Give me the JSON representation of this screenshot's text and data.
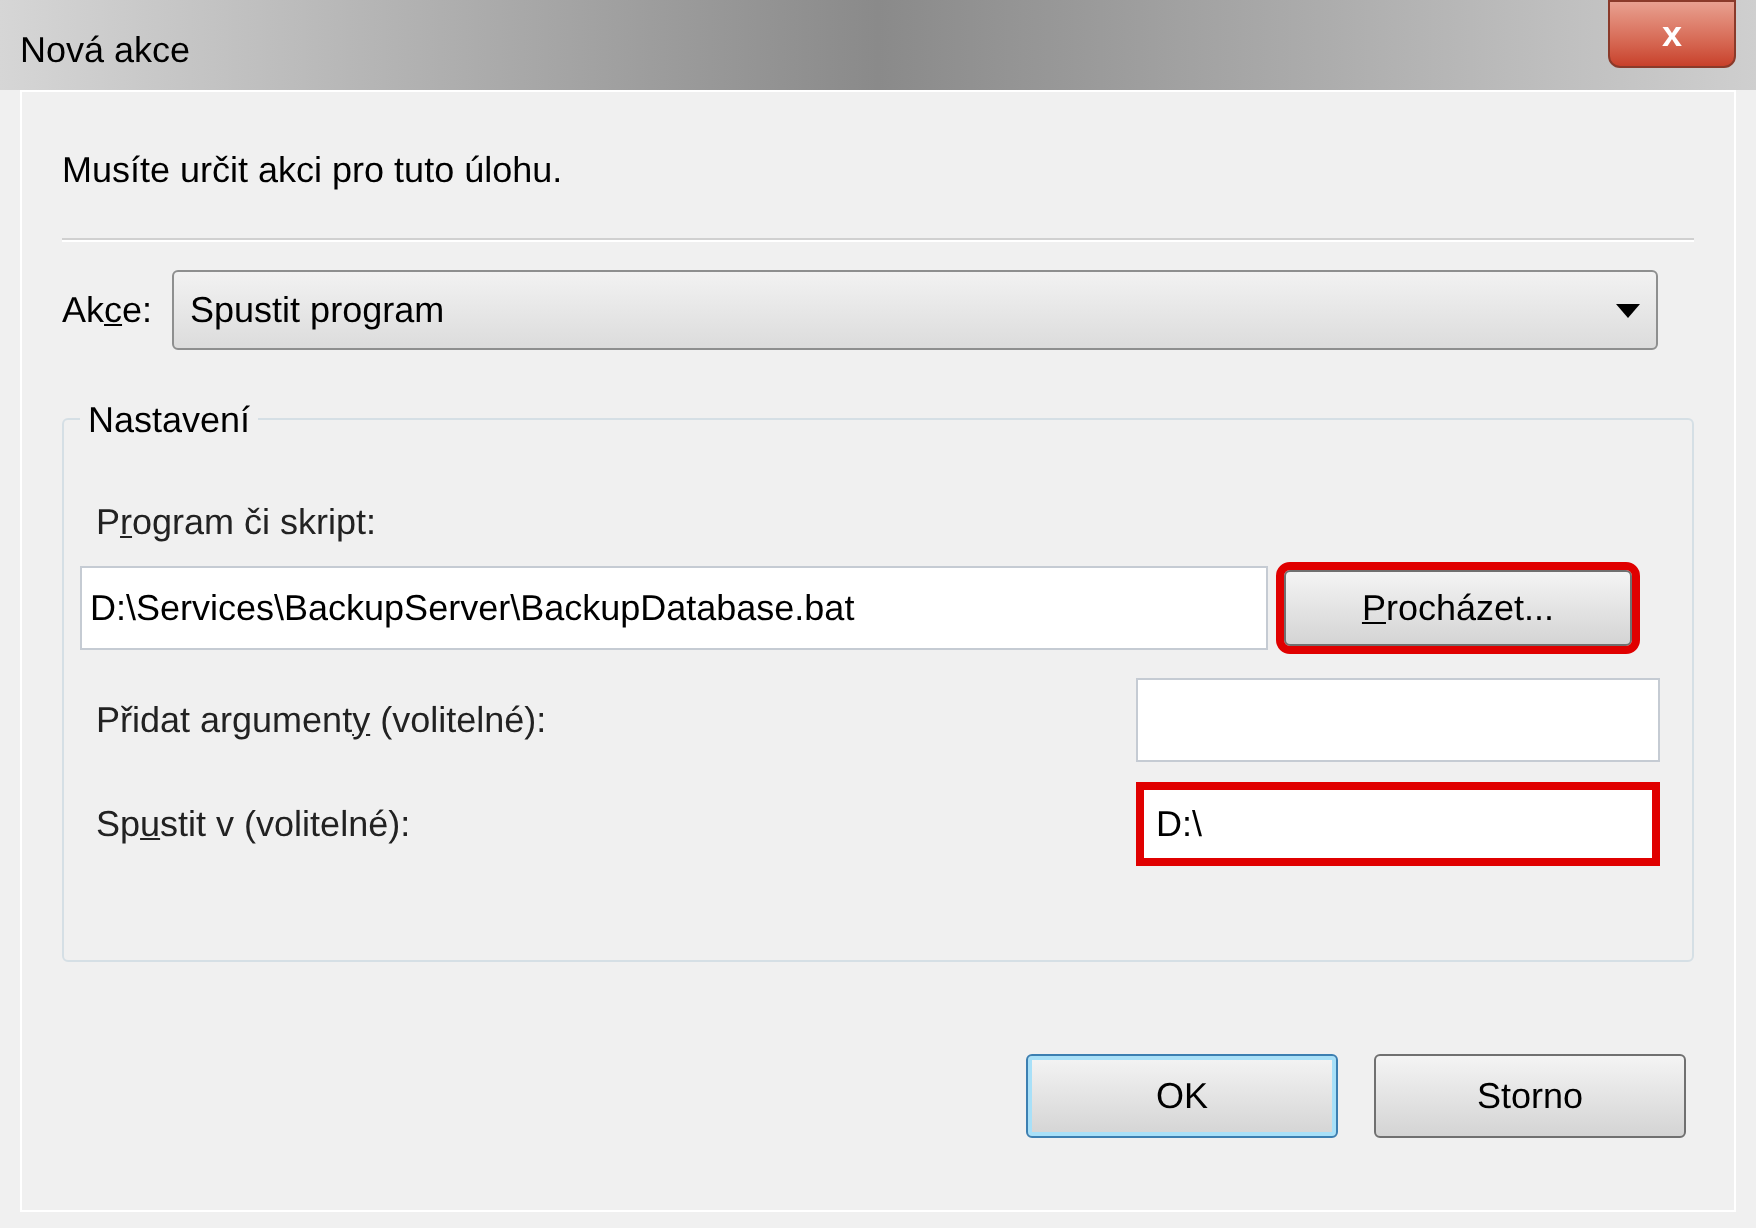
{
  "window": {
    "title": "Nová akce",
    "close_label": "x"
  },
  "instruction": "Musíte určit akci pro tuto úlohu.",
  "action": {
    "label": {
      "before": "Ak",
      "access_key": "c",
      "after": "e:"
    },
    "value": "Spustit program"
  },
  "settings": {
    "title": "Nastavení",
    "fields": [
      {
        "kind": "program",
        "label": {
          "before": "P",
          "access_key": "r",
          "after": "ogram či skript:"
        },
        "value": "D:\\Services\\BackupServer\\BackupDatabase.bat",
        "highlighted": false,
        "button": {
          "label": {
            "access_key": "P",
            "after": "rocházet..."
          },
          "highlighted": true
        }
      },
      {
        "kind": "inline",
        "label": {
          "before": "Přidat argument",
          "access_key": "y",
          "after": " (volitelné):"
        },
        "highlighted": false
      },
      {
        "kind": "inline",
        "label": {
          "before": "Sp",
          "access_key": "u",
          "after": "stit v (volitelné):"
        },
        "value": "D:\\",
        "highlighted": true
      }
    ]
  },
  "buttons": [
    {
      "label": "OK",
      "default": true
    },
    {
      "label": "Storno",
      "default": false
    }
  ]
}
